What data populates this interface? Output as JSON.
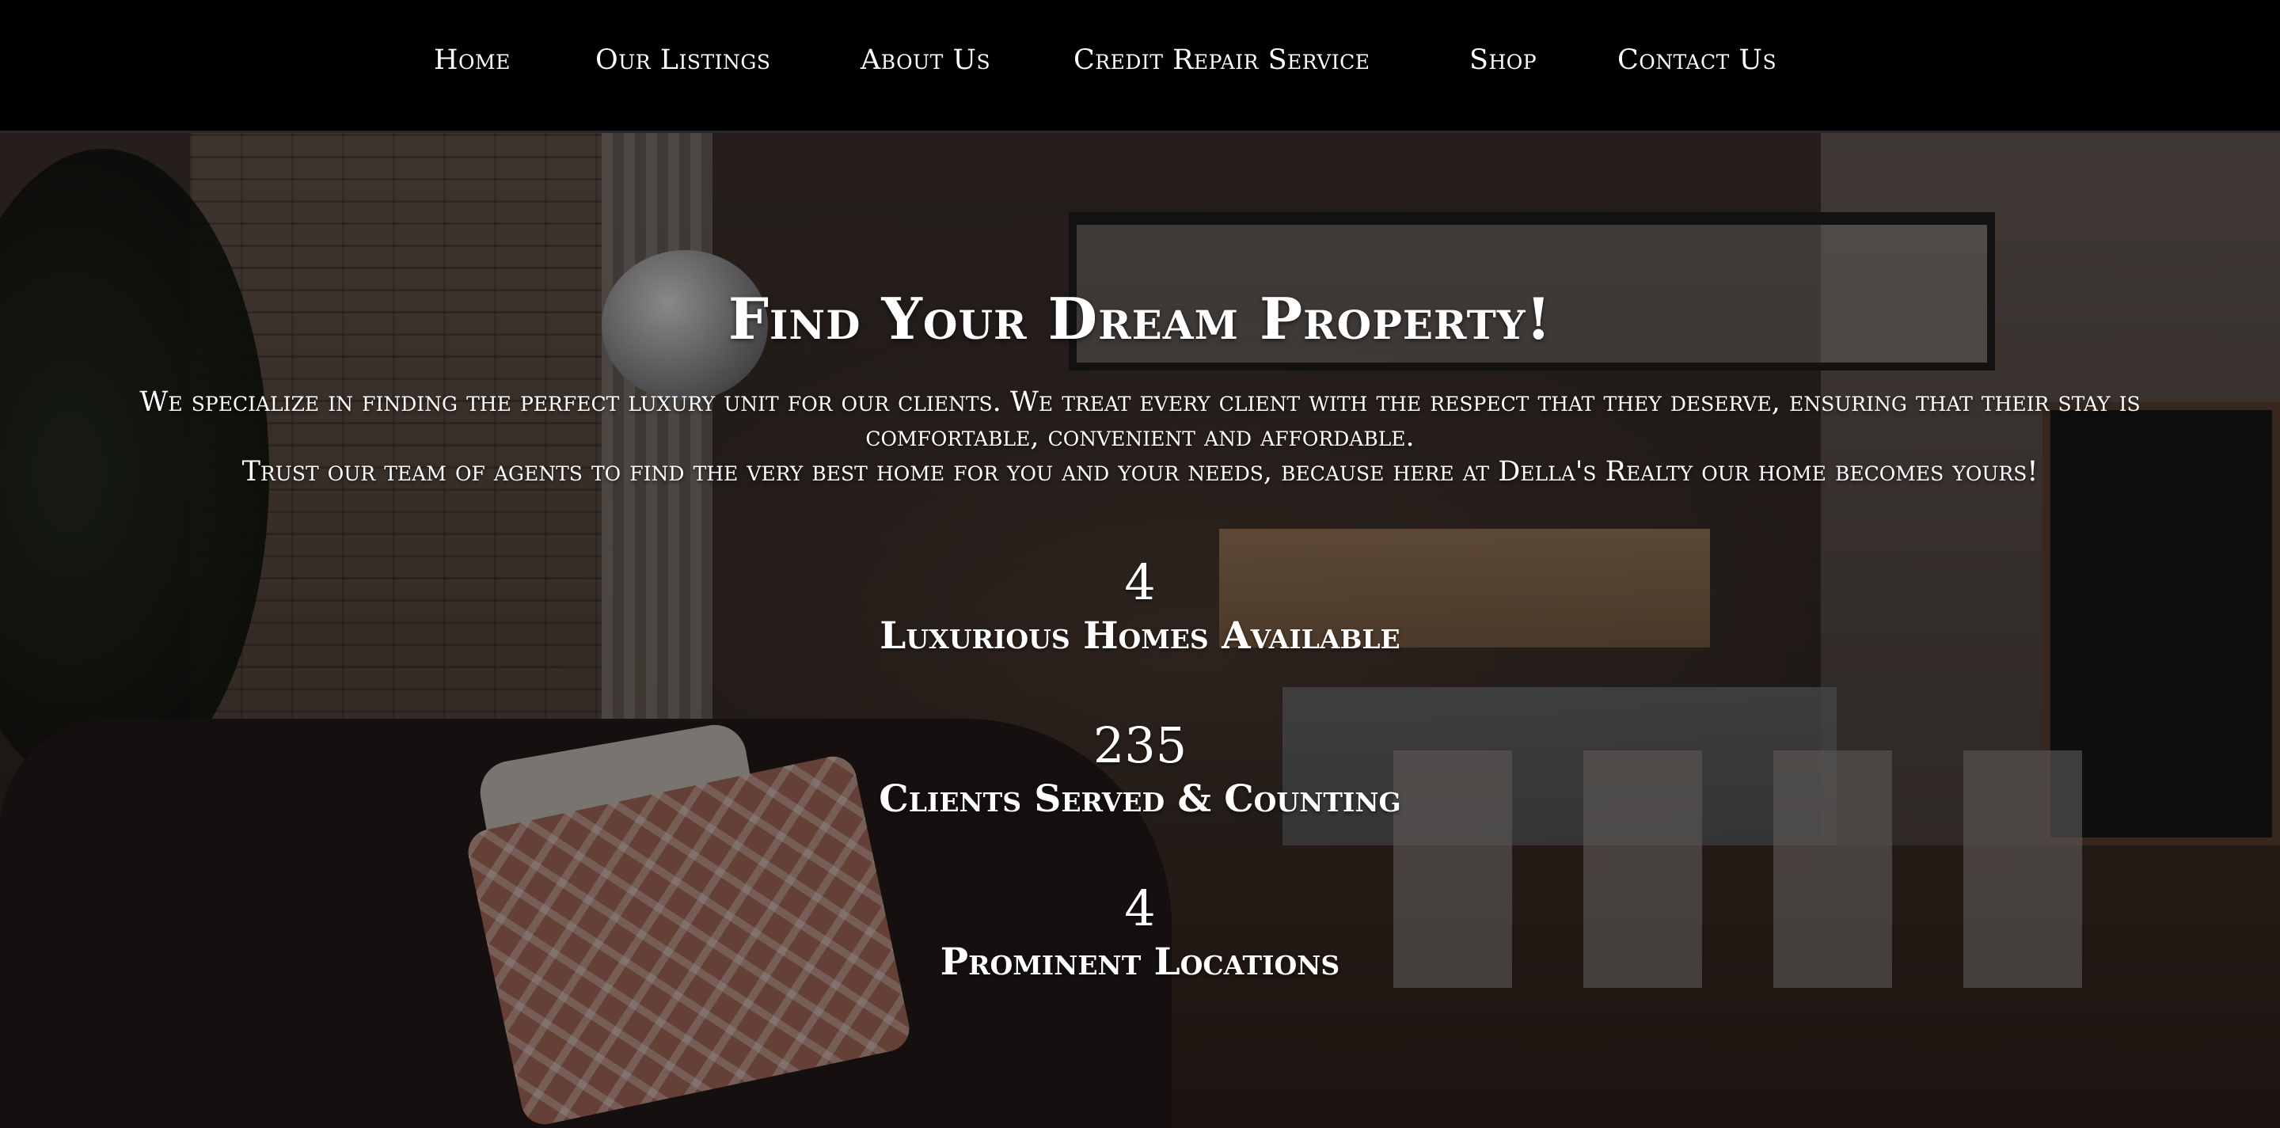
{
  "nav": {
    "items": [
      {
        "label": "Home"
      },
      {
        "label": "Our Listings"
      },
      {
        "label": "About Us"
      },
      {
        "label": "Credit Repair Service"
      },
      {
        "label": "Shop"
      },
      {
        "label": "Contact Us"
      }
    ]
  },
  "hero": {
    "title": "Find Your Dream Property!",
    "description": [
      "We specialize in finding the perfect luxury unit for our clients. We treat every client with the respect that they deserve, ensuring that their stay is comfortable, convenient and affordable.",
      "Trust our team of agents to find the very best home for you and your needs, because here at Della's Realty our home becomes yours!"
    ],
    "stats": [
      {
        "number": "4",
        "label": "Luxurious Homes Available"
      },
      {
        "number": "235",
        "label": "Clients Served & Counting"
      },
      {
        "number": "4",
        "label": "Prominent Locations"
      }
    ]
  }
}
